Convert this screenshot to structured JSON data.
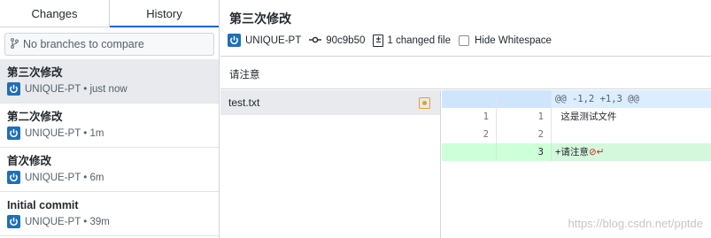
{
  "tabs": {
    "changes": "Changes",
    "history": "History"
  },
  "compare": {
    "placeholder": "No branches to compare",
    "icon": "branch-icon"
  },
  "commits": [
    {
      "title": "第三次修改",
      "meta": "UNIQUE-PT • just now"
    },
    {
      "title": "第二次修改",
      "meta": "UNIQUE-PT • 1m"
    },
    {
      "title": "首次修改",
      "meta": "UNIQUE-PT • 6m"
    },
    {
      "title": "Initial commit",
      "meta": "UNIQUE-PT • 39m"
    }
  ],
  "header": {
    "title": "第三次修改",
    "author": "UNIQUE-PT",
    "sha": "90c9b50",
    "changed": "1 changed file",
    "hide_whitespace": "Hide Whitespace"
  },
  "description": "请注意",
  "files": [
    {
      "name": "test.txt",
      "status": "modified"
    }
  ],
  "diff": {
    "hunk": "@@ -1,2 +1,3 @@",
    "lines": [
      {
        "old": "1",
        "new": "1",
        "text": " 这是测试文件"
      },
      {
        "old": "2",
        "new": "2",
        "text": ""
      },
      {
        "old": "",
        "new": "3",
        "text": "+请注意"
      }
    ],
    "no_newline_marker": "⊘↵"
  },
  "watermark": "https://blog.csdn.net/pptde",
  "colors": {
    "accent": "#0366d6",
    "avatar": "#1f6fb8",
    "added_bg": "#e6ffed",
    "hunk_bg": "#dbedff",
    "modified": "#d4a72c"
  }
}
